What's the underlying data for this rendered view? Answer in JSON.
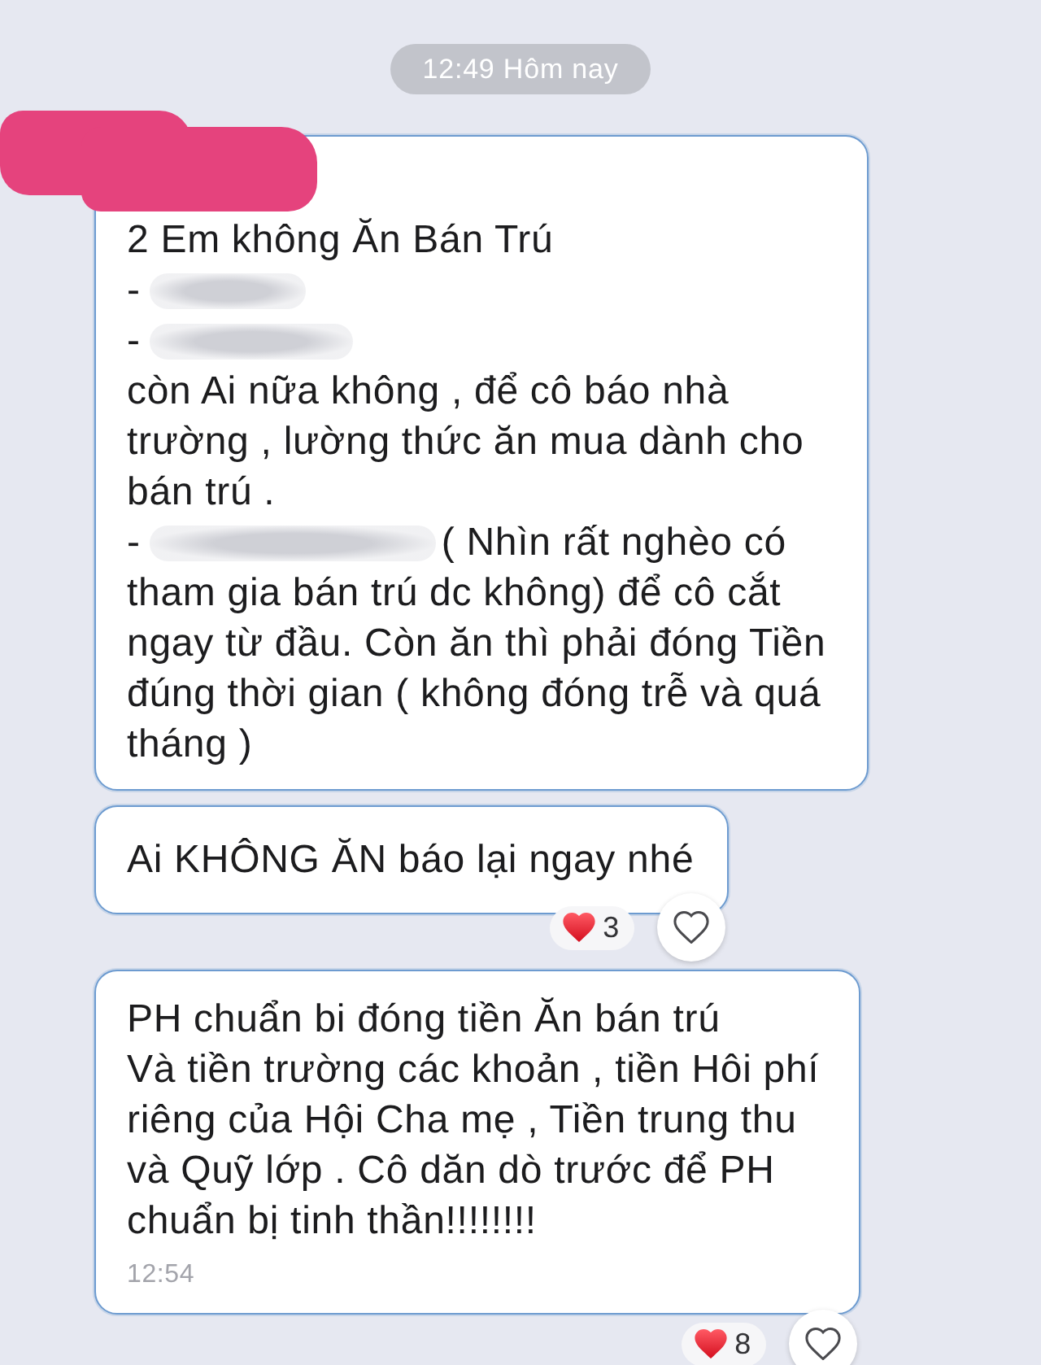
{
  "date_divider": "12:49 Hôm nay",
  "messages": [
    {
      "lines": [
        {
          "parts": [
            {
              "kind": "text",
              "text": "2 Em không Ăn Bán Trú"
            }
          ]
        },
        {
          "parts": [
            {
              "kind": "text",
              "text": "-"
            },
            {
              "kind": "blurred"
            }
          ]
        },
        {
          "parts": [
            {
              "kind": "text",
              "text": "-"
            },
            {
              "kind": "blurred"
            }
          ]
        },
        {
          "parts": [
            {
              "kind": "text",
              "text": "còn Ai nữa không , để cô báo nhà"
            }
          ]
        },
        {
          "parts": [
            {
              "kind": "text",
              "text": "trường , lường thức ăn mua dành cho"
            }
          ]
        },
        {
          "parts": [
            {
              "kind": "text",
              "text": "bán trú ."
            }
          ]
        },
        {
          "parts": [
            {
              "kind": "text",
              "text": "-"
            },
            {
              "kind": "blurred"
            },
            {
              "kind": "text",
              "text": "( Nhìn rất nghèo có"
            }
          ]
        },
        {
          "parts": [
            {
              "kind": "text",
              "text": "tham gia bán trú dc không) để cô cắt"
            }
          ]
        },
        {
          "parts": [
            {
              "kind": "text",
              "text": "ngay từ đầu. Còn ăn thì phải đóng Tiền"
            }
          ]
        },
        {
          "parts": [
            {
              "kind": "text",
              "text": "đúng thời gian ( không đóng trễ và quá"
            }
          ]
        },
        {
          "parts": [
            {
              "kind": "text",
              "text": "tháng )"
            }
          ]
        }
      ]
    },
    {
      "lines": [
        {
          "parts": [
            {
              "kind": "text",
              "text": "Ai KHÔNG ĂN báo lại ngay nhé"
            }
          ]
        }
      ],
      "reactions": {
        "count": "3"
      }
    },
    {
      "lines": [
        {
          "parts": [
            {
              "kind": "text",
              "text": "PH chuẩn bi đóng tiền Ăn bán trú"
            }
          ]
        },
        {
          "parts": [
            {
              "kind": "text",
              "text": "Và tiền trường các khoản , tiền Hôi phí"
            }
          ]
        },
        {
          "parts": [
            {
              "kind": "text",
              "text": "riêng của Hội Cha mẹ , Tiền trung thu"
            }
          ]
        },
        {
          "parts": [
            {
              "kind": "text",
              "text": "và Quỹ lớp . Cô dăn dò trước để PH"
            }
          ]
        },
        {
          "parts": [
            {
              "kind": "text",
              "text": "chuẩn bị tinh thần!!!!!!!!"
            }
          ]
        }
      ],
      "time": "12:54",
      "reactions": {
        "count": "8"
      }
    }
  ]
}
